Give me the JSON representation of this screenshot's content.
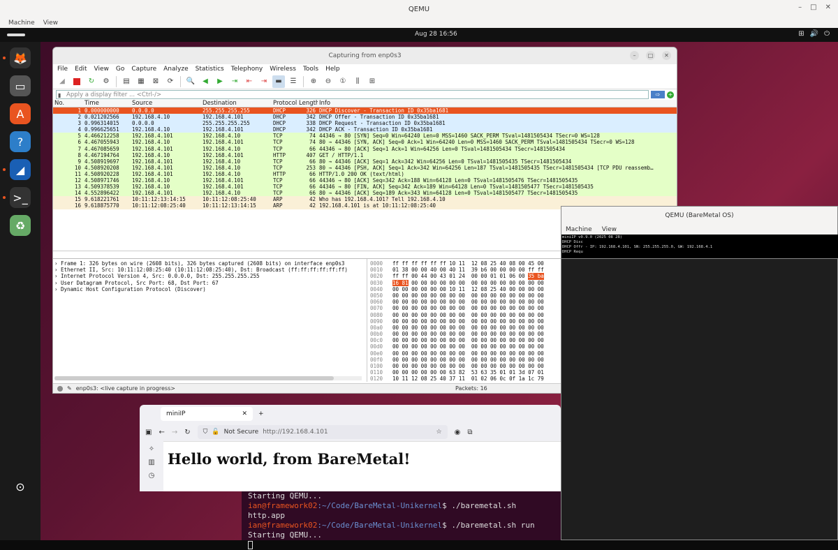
{
  "host": {
    "title": "QEMU",
    "menu": [
      "Machine",
      "View"
    ],
    "controls": [
      "–",
      "□",
      "✕"
    ]
  },
  "topbar": {
    "clock": "Aug 28  16:56",
    "tray": [
      "⊞",
      "🔊",
      "⏻"
    ]
  },
  "dock": [
    {
      "icon": "firefox-icon",
      "glyph": "🦊",
      "bg": "#333",
      "dot": true
    },
    {
      "icon": "files-icon",
      "glyph": "▭",
      "bg": "#555",
      "dot": false
    },
    {
      "icon": "app-center-icon",
      "glyph": "A",
      "bg": "#e95420",
      "dot": false
    },
    {
      "icon": "help-icon",
      "glyph": "?",
      "bg": "#2d7ec9",
      "dot": false
    },
    {
      "icon": "wireshark-icon",
      "glyph": "◢",
      "bg": "#1a5fb4",
      "dot": true
    },
    {
      "icon": "terminal-icon",
      "glyph": ">_",
      "bg": "#333",
      "dot": true
    },
    {
      "icon": "trash-icon",
      "glyph": "♻",
      "bg": "#6a6",
      "dot": false
    },
    {
      "icon": "show-apps-icon",
      "glyph": "⊙",
      "bg": "transparent",
      "dot": false
    }
  ],
  "wireshark": {
    "title": "Capturing from enp0s3",
    "menu": [
      "File",
      "Edit",
      "View",
      "Go",
      "Capture",
      "Analyze",
      "Statistics",
      "Telephony",
      "Wireless",
      "Tools",
      "Help"
    ],
    "filter_placeholder": "Apply a display filter ... <Ctrl-/>",
    "columns": [
      "No.",
      "Time",
      "Source",
      "Destination",
      "Protocol",
      "Length",
      "Info"
    ],
    "packets": [
      {
        "no": "1",
        "time": "0.000000000",
        "src": "0.0.0.0",
        "dst": "255.255.255.255",
        "proto": "DHCP",
        "len": "326",
        "info": "DHCP Discover - Transaction ID 0x35ba1681",
        "bg": "#e95420",
        "fg": "#fff"
      },
      {
        "no": "2",
        "time": "0.021202566",
        "src": "192.168.4.10",
        "dst": "192.168.4.101",
        "proto": "DHCP",
        "len": "342",
        "info": "DHCP Offer    - Transaction ID 0x35ba1681",
        "bg": "#daeeff",
        "fg": "#111"
      },
      {
        "no": "3",
        "time": "0.996314015",
        "src": "0.0.0.0",
        "dst": "255.255.255.255",
        "proto": "DHCP",
        "len": "338",
        "info": "DHCP Request  - Transaction ID 0x35ba1681",
        "bg": "#daeeff",
        "fg": "#111"
      },
      {
        "no": "4",
        "time": "0.996625651",
        "src": "192.168.4.10",
        "dst": "192.168.4.101",
        "proto": "DHCP",
        "len": "342",
        "info": "DHCP ACK      - Transaction ID 0x35ba1681",
        "bg": "#daeeff",
        "fg": "#111"
      },
      {
        "no": "5",
        "time": "4.466212258",
        "src": "192.168.4.101",
        "dst": "192.168.4.10",
        "proto": "TCP",
        "len": "74",
        "info": "44346 → 80 [SYN] Seq=0 Win=64240 Len=0 MSS=1460 SACK_PERM TSval=1481505434 TSecr=0 WS=128",
        "bg": "#e4ffc7",
        "fg": "#111"
      },
      {
        "no": "6",
        "time": "4.467055943",
        "src": "192.168.4.10",
        "dst": "192.168.4.101",
        "proto": "TCP",
        "len": "74",
        "info": "80 → 44346 [SYN, ACK] Seq=0 Ack=1 Win=64240 Len=0 MSS=1460 SACK_PERM TSval=1481505434 TSecr=0 WS=128",
        "bg": "#e4ffc7",
        "fg": "#111"
      },
      {
        "no": "7",
        "time": "4.467085659",
        "src": "192.168.4.101",
        "dst": "192.168.4.10",
        "proto": "TCP",
        "len": "66",
        "info": "44346 → 80 [ACK] Seq=1 Ack=1 Win=64256 Len=0 TSval=1481505434 TSecr=1481505434",
        "bg": "#e4ffc7",
        "fg": "#111"
      },
      {
        "no": "8",
        "time": "4.467194764",
        "src": "192.168.4.10",
        "dst": "192.168.4.101",
        "proto": "HTTP",
        "len": "407",
        "info": "GET / HTTP/1.1",
        "bg": "#e4ffc7",
        "fg": "#111"
      },
      {
        "no": "9",
        "time": "4.508919697",
        "src": "192.168.4.101",
        "dst": "192.168.4.10",
        "proto": "TCP",
        "len": "66",
        "info": "80 → 44346 [ACK] Seq=1 Ack=342 Win=64256 Len=0 TSval=1481505435 TSecr=1481505434",
        "bg": "#e4ffc7",
        "fg": "#111"
      },
      {
        "no": "10",
        "time": "4.508920208",
        "src": "192.168.4.101",
        "dst": "192.168.4.10",
        "proto": "TCP",
        "len": "253",
        "info": "80 → 44346 [PSH, ACK] Seq=1 Ack=342 Win=64256 Len=187 TSval=1481505435 TSecr=1481505434 [TCP PDU reassemb…",
        "bg": "#e4ffc7",
        "fg": "#111"
      },
      {
        "no": "11",
        "time": "4.508920228",
        "src": "192.168.4.101",
        "dst": "192.168.4.10",
        "proto": "HTTP",
        "len": "66",
        "info": "HTTP/1.0 200 OK  (text/html)",
        "bg": "#e4ffc7",
        "fg": "#111"
      },
      {
        "no": "12",
        "time": "4.508971746",
        "src": "192.168.4.10",
        "dst": "192.168.4.101",
        "proto": "TCP",
        "len": "66",
        "info": "44346 → 80 [ACK] Seq=342 Ack=188 Win=64128 Len=0 TSval=1481505476 TSecr=1481505435",
        "bg": "#e4ffc7",
        "fg": "#111"
      },
      {
        "no": "13",
        "time": "4.509378539",
        "src": "192.168.4.10",
        "dst": "192.168.4.101",
        "proto": "TCP",
        "len": "66",
        "info": "44346 → 80 [FIN, ACK] Seq=342 Ack=189 Win=64128 Len=0 TSval=1481505477 TSecr=1481505435",
        "bg": "#e4ffc7",
        "fg": "#111"
      },
      {
        "no": "14",
        "time": "4.552896422",
        "src": "192.168.4.101",
        "dst": "192.168.4.10",
        "proto": "TCP",
        "len": "66",
        "info": "80 → 44346 [ACK] Seq=189 Ack=343 Win=64128 Len=0 TSval=1481505477 TSecr=1481505435",
        "bg": "#e4ffc7",
        "fg": "#111"
      },
      {
        "no": "15",
        "time": "9.618221761",
        "src": "10:11:12:13:14:15",
        "dst": "10:11:12:08:25:40",
        "proto": "ARP",
        "len": "42",
        "info": "Who has 192.168.4.101? Tell 192.168.4.10",
        "bg": "#faf0d7",
        "fg": "#111"
      },
      {
        "no": "16",
        "time": "9.618875770",
        "src": "10:11:12:08:25:40",
        "dst": "10:11:12:13:14:15",
        "proto": "ARP",
        "len": "42",
        "info": "192.168.4.101 is at 10:11:12:08:25:40",
        "bg": "#faf0d7",
        "fg": "#111"
      }
    ],
    "details": [
      "› Frame 1: 326 bytes on wire (2608 bits), 326 bytes captured (2608 bits) on interface enp0s3",
      "› Ethernet II, Src: 10:11:12:08:25:40 (10:11:12:08:25:40), Dst: Broadcast (ff:ff:ff:ff:ff:ff)",
      "› Internet Protocol Version 4, Src: 0.0.0.0, Dst: 255.255.255.255",
      "› User Datagram Protocol, Src Port: 68, Dst Port: 67",
      "› Dynamic Host Configuration Protocol (Discover)"
    ],
    "hex": [
      {
        "off": "0000",
        "a": "ff ff ff ff ff ff 10 11  12 08 25 40 08 00 45 00",
        "hl": ""
      },
      {
        "off": "0010",
        "a": "01 38 00 00 40 00 40 11  39 b6 00 00 00 00 ff ff",
        "hl": ""
      },
      {
        "off": "0020",
        "a": "ff ff 00 44 00 43 01 24  00 00 01 01 06 00 ",
        "hl": "35 ba"
      },
      {
        "off": "0030",
        "a": "",
        "hl": "16 81",
        "b": " 00 00 00 00 00 00  00 00 00 00 00 00 00 00"
      },
      {
        "off": "0040",
        "a": "00 00 00 00 00 00 10 11  12 08 25 40 00 00 00 00",
        "hl": ""
      },
      {
        "off": "0050",
        "a": "00 00 00 00 00 00 00 00  00 00 00 00 00 00 00 00",
        "hl": ""
      },
      {
        "off": "0060",
        "a": "00 00 00 00 00 00 00 00  00 00 00 00 00 00 00 00",
        "hl": ""
      },
      {
        "off": "0070",
        "a": "00 00 00 00 00 00 00 00  00 00 00 00 00 00 00 00",
        "hl": ""
      },
      {
        "off": "0080",
        "a": "00 00 00 00 00 00 00 00  00 00 00 00 00 00 00 00",
        "hl": ""
      },
      {
        "off": "0090",
        "a": "00 00 00 00 00 00 00 00  00 00 00 00 00 00 00 00",
        "hl": ""
      },
      {
        "off": "00a0",
        "a": "00 00 00 00 00 00 00 00  00 00 00 00 00 00 00 00",
        "hl": ""
      },
      {
        "off": "00b0",
        "a": "00 00 00 00 00 00 00 00  00 00 00 00 00 00 00 00",
        "hl": ""
      },
      {
        "off": "00c0",
        "a": "00 00 00 00 00 00 00 00  00 00 00 00 00 00 00 00",
        "hl": ""
      },
      {
        "off": "00d0",
        "a": "00 00 00 00 00 00 00 00  00 00 00 00 00 00 00 00",
        "hl": ""
      },
      {
        "off": "00e0",
        "a": "00 00 00 00 00 00 00 00  00 00 00 00 00 00 00 00",
        "hl": ""
      },
      {
        "off": "00f0",
        "a": "00 00 00 00 00 00 00 00  00 00 00 00 00 00 00 00",
        "hl": ""
      },
      {
        "off": "0100",
        "a": "00 00 00 00 00 00 00 00  00 00 00 00 00 00 00 00",
        "hl": ""
      },
      {
        "off": "0110",
        "a": "00 00 00 00 00 00 63 82  53 63 35 01 01 3d 07 01",
        "hl": ""
      },
      {
        "off": "0120",
        "a": "10 11 12 08 25 40 37 11  01 02 06 0c 0f 1a 1c 79",
        "hl": ""
      }
    ],
    "status_capture": "enp0s3: <live capture in progress>",
    "status_packets": "Packets: 16"
  },
  "qemu2": {
    "title": "QEMU (BareMetal OS)",
    "menu": [
      "Machine",
      "View"
    ],
    "console": [
      "miniIP v0.9.0 (2025 08 28)",
      "DHCP Disc",
      "DHCP Offr - IP: 192.168.4.101, SN: 255.255.255.0, GW: 192.168.4.1",
      "DHCP Requ"
    ]
  },
  "firefox": {
    "tab_title": "miniIP",
    "security": "Not Secure",
    "url": "http://192.168.4.101",
    "heading": "Hello world, from BareMetal!"
  },
  "terminal": {
    "lines": [
      {
        "plain": "Starting QEMU..."
      },
      {
        "user": "ian@framework02",
        "path": ":~/Code/BareMetal-Unikernel",
        "cmd": "$ ./baremetal.sh http.app"
      },
      {
        "user": "ian@framework02",
        "path": ":~/Code/BareMetal-Unikernel",
        "cmd": "$ ./baremetal.sh run"
      },
      {
        "plain": "Starting QEMU..."
      }
    ]
  }
}
